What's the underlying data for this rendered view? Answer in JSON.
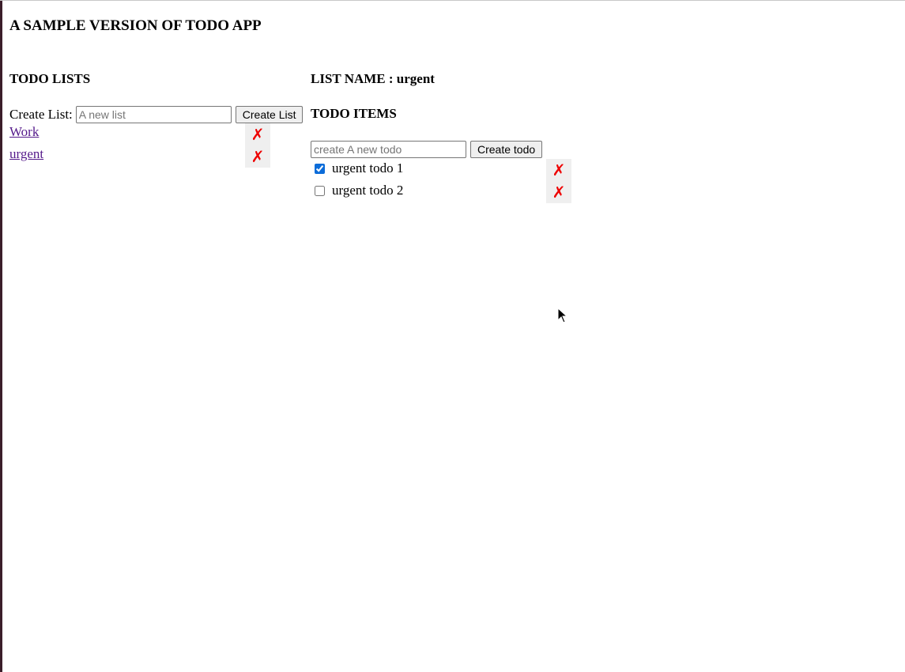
{
  "app": {
    "title": "A SAMPLE VERSION OF TODO APP"
  },
  "lists_panel": {
    "heading": "TODO LISTS",
    "create_label": "Create List:",
    "create_placeholder": "A new list",
    "create_button": "Create List",
    "lists": [
      {
        "name": "Work",
        "delete_glyph": "✗"
      },
      {
        "name": "urgent",
        "delete_glyph": "✗"
      }
    ]
  },
  "items_panel": {
    "list_name_heading": "LIST NAME : urgent",
    "items_heading": "TODO ITEMS",
    "create_placeholder": "create A new todo",
    "create_button": "Create todo",
    "todos": [
      {
        "text": "urgent todo 1",
        "checked": true,
        "delete_glyph": "✗"
      },
      {
        "text": "urgent todo 2",
        "checked": false,
        "delete_glyph": "✗"
      }
    ]
  },
  "colors": {
    "delete_icon": "#ee0000",
    "visited_link": "#551a8b",
    "checkbox_accent": "#0b6cd9"
  }
}
